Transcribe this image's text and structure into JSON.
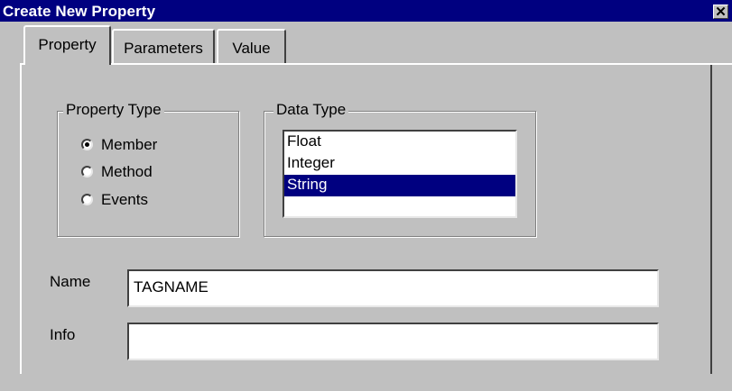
{
  "window": {
    "title": "Create New Property",
    "close_glyph": "✕"
  },
  "tabs": [
    {
      "label": "Property",
      "active": true
    },
    {
      "label": "Parameters",
      "active": false
    },
    {
      "label": "Value",
      "active": false
    }
  ],
  "property_type": {
    "label": "Property Type",
    "options": [
      {
        "label": "Member",
        "checked": true
      },
      {
        "label": "Method",
        "checked": false
      },
      {
        "label": "Events",
        "checked": false
      }
    ]
  },
  "data_type": {
    "label": "Data Type",
    "items": [
      {
        "label": "Float",
        "selected": false
      },
      {
        "label": "Integer",
        "selected": false
      },
      {
        "label": "String",
        "selected": true
      }
    ]
  },
  "fields": {
    "name_label": "Name",
    "name_value": "TAGNAME",
    "info_label": "Info",
    "info_value": ""
  },
  "colors": {
    "titlebar": "#000080",
    "face": "#c0c0c0",
    "selection": "#000080"
  }
}
